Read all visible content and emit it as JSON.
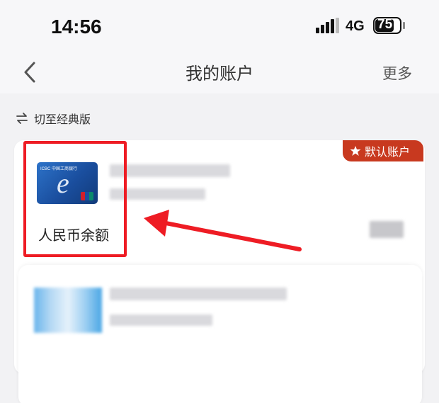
{
  "status_bar": {
    "time": "14:56",
    "network": "4G",
    "battery": "75",
    "battery_level": 0.75
  },
  "nav": {
    "title": "我的账户",
    "more": "更多"
  },
  "switch_classic": "切至经典版",
  "account_card": {
    "default_badge": "默认账户",
    "bank_card_text": "ICBC 中国工商银行",
    "balance_label": "人民币余额"
  },
  "icons": [
    "back-icon",
    "switch-arrows-icon",
    "star-icon",
    "unionpay-icon"
  ],
  "colors": {
    "highlight": "#ee1c24",
    "badge": "#c8391f",
    "card_blue": "#1a4e9e"
  }
}
